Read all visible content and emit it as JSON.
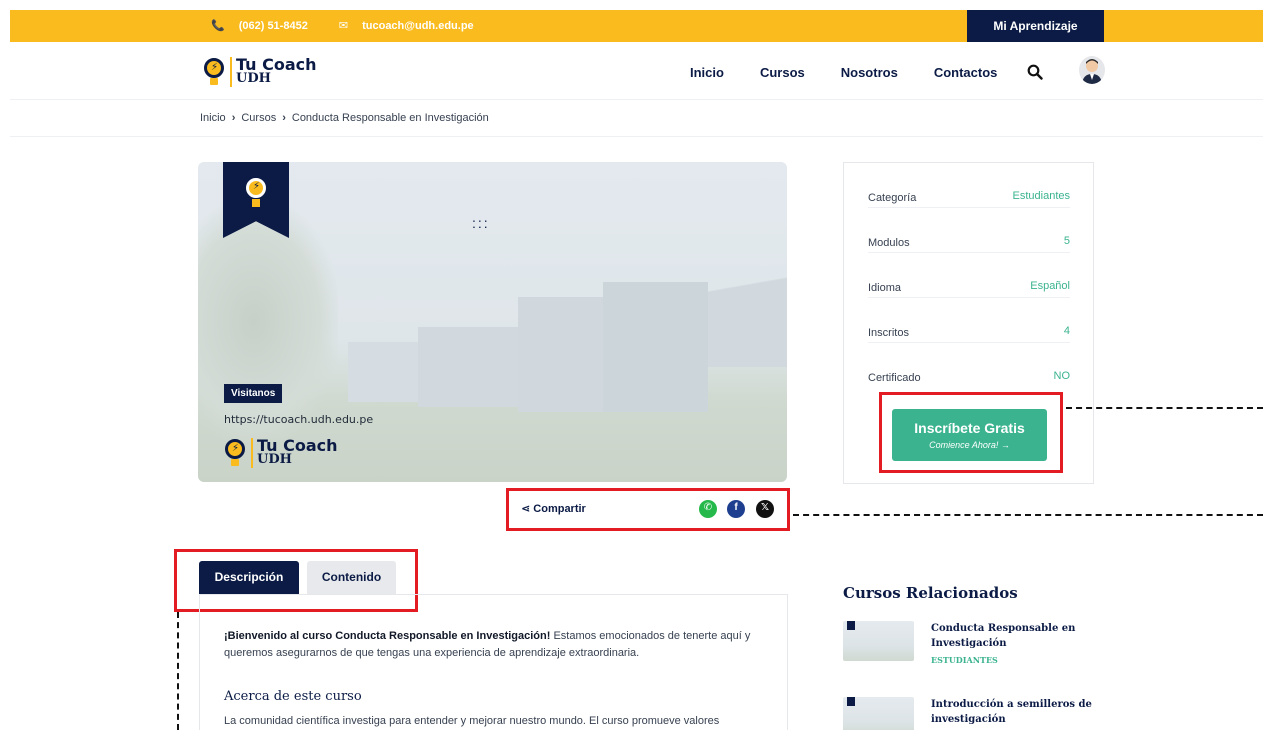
{
  "topbar": {
    "phone": "(062) 51-8452",
    "email": "tucoach@udh.edu.pe",
    "mi_aprendizaje": "Mi Aprendizaje"
  },
  "brand": {
    "line1": "Tu Coach",
    "line2": "UDH"
  },
  "nav": {
    "items": [
      "Inicio",
      "Cursos",
      "Nosotros",
      "Contactos"
    ]
  },
  "breadcrumb": {
    "items": [
      "Inicio",
      "Cursos",
      "Conducta Responsable en Investigación"
    ]
  },
  "hero": {
    "visit_label": "Visitanos",
    "url": "https://tucoach.udh.edu.pe",
    "logo_line1": "Tu Coach",
    "logo_line2": "UDH"
  },
  "share": {
    "label": "Compartir"
  },
  "info": {
    "rows": [
      {
        "key": "Categoría",
        "value": "Estudiantes"
      },
      {
        "key": "Modulos",
        "value": "5"
      },
      {
        "key": "Idioma",
        "value": "Español"
      },
      {
        "key": "Inscritos",
        "value": "4"
      },
      {
        "key": "Certificado",
        "value": "NO"
      }
    ]
  },
  "enroll": {
    "title": "Inscríbete Gratis",
    "subtitle": "Comience Ahora! →"
  },
  "tabs": [
    "Descripción",
    "Contenido"
  ],
  "description": {
    "welcome_bold": "¡Bienvenido al curso Conducta Responsable en Investigación!",
    "welcome_rest": " Estamos emocionados de tenerte aquí y queremos asegurarnos de que tengas una experiencia de aprendizaje extraordinaria.",
    "about_title": "Acerca de este curso",
    "about_text": "La comunidad científica investiga para entender y mejorar nuestro mundo. El curso promueve valores"
  },
  "related": {
    "title": "Cursos Relacionados",
    "items": [
      {
        "title": "Conducta Responsable en Investigación",
        "category": "ESTUDIANTES"
      },
      {
        "title": "Introducción a semilleros de investigación",
        "category": ""
      }
    ]
  },
  "colors": {
    "accent": "#f9bb1e",
    "navy": "#0b1b45",
    "green": "#3bb38f",
    "highlight": "#e31b23"
  }
}
